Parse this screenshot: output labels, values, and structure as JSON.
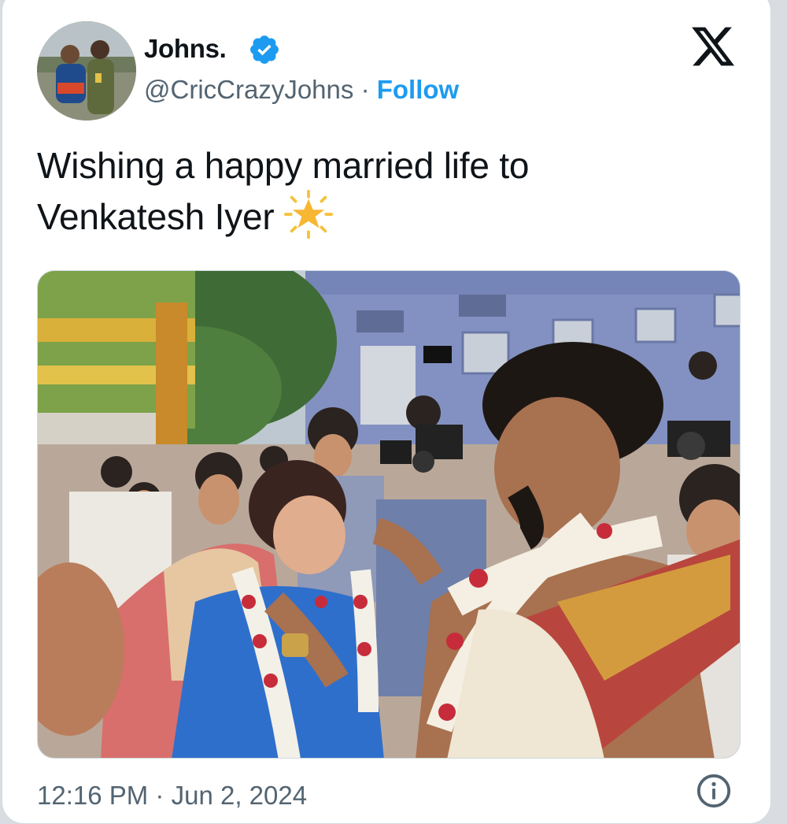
{
  "author": {
    "display_name": "Johns.",
    "handle": "@CricCrazyJohns",
    "separator": "·",
    "follow_label": "Follow",
    "verified_color": "#1d9bf0"
  },
  "tweet": {
    "text_line1": "Wishing a happy married life to",
    "text_line2": "Venkatesh Iyer",
    "emoji": "sparkle-star"
  },
  "meta": {
    "time": "12:16 PM",
    "separator": "·",
    "date": "Jun 2, 2024"
  },
  "icons": {
    "close": "x-logo-icon",
    "info": "info-icon",
    "verified": "verified-badge-icon"
  },
  "colors": {
    "accent": "#1d9bf0",
    "text_primary": "#0f1419",
    "text_secondary": "#536471"
  }
}
